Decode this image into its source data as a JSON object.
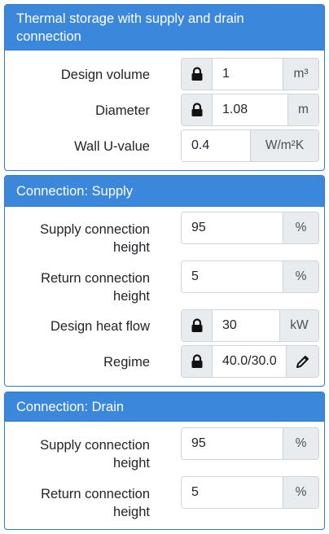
{
  "panels": {
    "thermal": {
      "title": "Thermal storage with supply and drain connection",
      "design_volume": {
        "label": "Design volume",
        "value": "1",
        "unit": "m³"
      },
      "diameter": {
        "label": "Diameter",
        "value": "1.08",
        "unit": "m"
      },
      "wall_u": {
        "label": "Wall U-value",
        "value": "0.4",
        "unit": "W/m²K"
      }
    },
    "supply": {
      "title": "Connection: Supply",
      "supply_height": {
        "label_1": "Supply connection",
        "label_2": "height",
        "value": "95",
        "unit": "%"
      },
      "return_height": {
        "label_1": "Return connection",
        "label_2": "height",
        "value": "5",
        "unit": "%"
      },
      "heat_flow": {
        "label": "Design heat flow",
        "value": "30",
        "unit": "kW"
      },
      "regime": {
        "label": "Regime",
        "value": "40.0/30.0"
      }
    },
    "drain": {
      "title": "Connection: Drain",
      "supply_height": {
        "label_1": "Supply connection",
        "label_2": "height",
        "value": "95",
        "unit": "%"
      },
      "return_height": {
        "label_1": "Return connection",
        "label_2": "height",
        "value": "5",
        "unit": "%"
      }
    }
  },
  "icons": {
    "lock": "lock-icon",
    "edit": "pencil-icon"
  }
}
